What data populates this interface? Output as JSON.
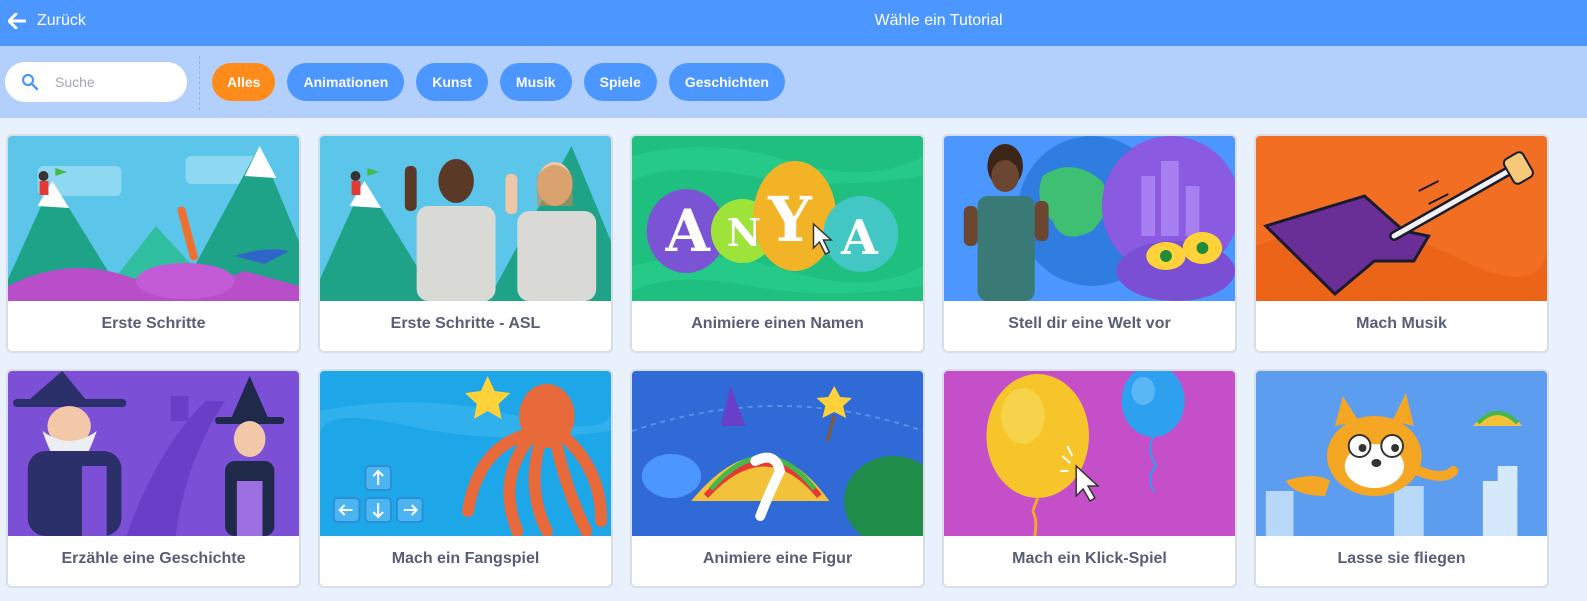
{
  "header": {
    "back_label": "Zurück",
    "title": "Wähle ein Tutorial"
  },
  "search": {
    "placeholder": "Suche",
    "value": ""
  },
  "tags": [
    {
      "label": "Alles",
      "active": true
    },
    {
      "label": "Animationen",
      "active": false
    },
    {
      "label": "Kunst",
      "active": false
    },
    {
      "label": "Musik",
      "active": false
    },
    {
      "label": "Spiele",
      "active": false
    },
    {
      "label": "Geschichten",
      "active": false
    }
  ],
  "cards": [
    {
      "label": "Erste Schritte"
    },
    {
      "label": "Erste Schritte - ASL"
    },
    {
      "label": "Animiere einen Namen",
      "thumb_text": "ANYA"
    },
    {
      "label": "Stell dir eine Welt vor"
    },
    {
      "label": "Mach Musik"
    },
    {
      "label": "Erzähle eine Geschichte"
    },
    {
      "label": "Mach ein Fangspiel"
    },
    {
      "label": "Animiere eine Figur"
    },
    {
      "label": "Mach ein Klick-Spiel"
    },
    {
      "label": "Lasse sie fliegen"
    }
  ],
  "colors": {
    "header": "#4c97ff",
    "filterbar": "#b3d0fd",
    "tag": "#4c97ff",
    "tag_active": "#ff8c1a",
    "card_text": "#575e75"
  },
  "icons": {
    "back": "arrow-left-icon",
    "search": "search-icon"
  }
}
